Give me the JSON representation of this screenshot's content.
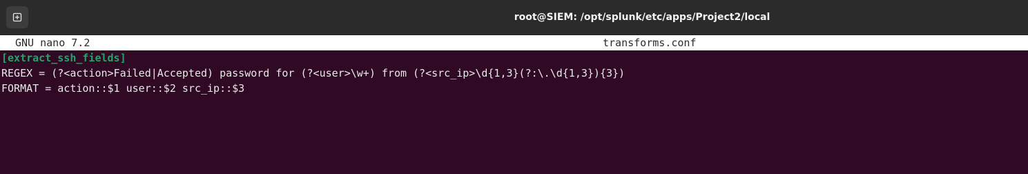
{
  "window": {
    "title": "root@SIEM: /opt/splunk/etc/apps/Project2/local"
  },
  "titlebar": {
    "new_tab_icon": "new-tab-plus-icon"
  },
  "nano": {
    "version": "GNU nano 7.2",
    "filename": "transforms.conf"
  },
  "editor": {
    "lines": [
      "[extract_ssh_fields]",
      "REGEX = (?<action>Failed|Accepted) password for (?<user>\\w+) from (?<src_ip>\\d{1,3}(?:\\.\\d{1,3}){3})",
      "FORMAT = action::$1 user::$2 src_ip::$3"
    ]
  },
  "colors": {
    "terminal_bg": "#300a24",
    "titlebar_bg": "#2b2b2b",
    "section_header": "#26a269",
    "text": "#e8e8e8"
  }
}
